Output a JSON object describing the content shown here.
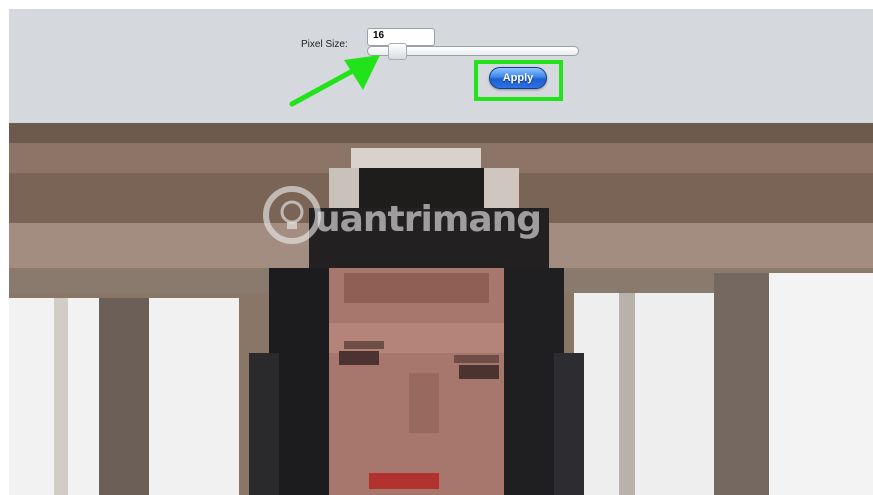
{
  "toolbar": {
    "pixel_size_label": "Pixel Size:",
    "pixel_size_value": "16",
    "slider": {
      "min": 1,
      "max": 128,
      "value": 16
    },
    "apply_label": "Apply"
  },
  "annotation": {
    "arrow_color": "#22e21a",
    "highlight_color": "#22e21a"
  },
  "watermark": {
    "text": "uantrimang",
    "icon": "lightbulb-icon"
  },
  "colors": {
    "toolbar_bg": "#d5d9dd",
    "apply_button": "#2b72e4"
  }
}
